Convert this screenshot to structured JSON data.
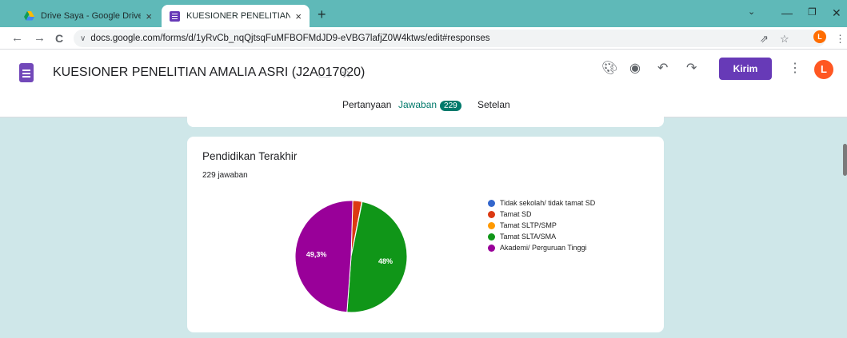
{
  "browser": {
    "tabs": [
      {
        "title": "Drive Saya - Google Drive",
        "close": "×"
      },
      {
        "title": "KUESIONER PENELITIAN AMALIA",
        "close": "×"
      }
    ],
    "new_tab": "+",
    "window_controls": {
      "minimize": "—",
      "restore": "❐",
      "close": "✕",
      "menu": "⌄"
    },
    "nav": {
      "back": "←",
      "forward": "→",
      "reload": "C"
    },
    "url": "docs.google.com/forms/d/1yRvCb_nqQjtsqFuMFBOFMdJD9-eVBG7lafjZ0W4ktws/edit#responses",
    "profile_initial": "L"
  },
  "form": {
    "title": "KUESIONER PENELITIAN AMALIA ASRI (J2A017020)",
    "send_label": "Kirim",
    "avatar_initial": "L",
    "tabs": [
      {
        "label": "Pertanyaan"
      },
      {
        "label": "Jawaban",
        "count": "229"
      },
      {
        "label": "Setelan"
      }
    ]
  },
  "card": {
    "title": "Pendidikan Terakhir",
    "responses": "229 jawaban"
  },
  "chart_data": {
    "type": "pie",
    "title": "Pendidikan Terakhir",
    "categories": [
      "Tidak sekolah/ tidak tamat SD",
      "Tamat SD",
      "Tamat SLTP/SMP",
      "Tamat SLTA/SMA",
      "Akademi/ Perguruan Tinggi"
    ],
    "values": [
      0.0,
      2.6,
      0.1,
      48.0,
      49.3
    ],
    "colors": [
      "#3366cc",
      "#dc3912",
      "#ff9900",
      "#109618",
      "#990099"
    ],
    "labels": {
      "Tamat SLTA/SMA": "48%",
      "Akademi/ Perguruan Tinggi": "49,3%"
    },
    "legend": "right"
  }
}
